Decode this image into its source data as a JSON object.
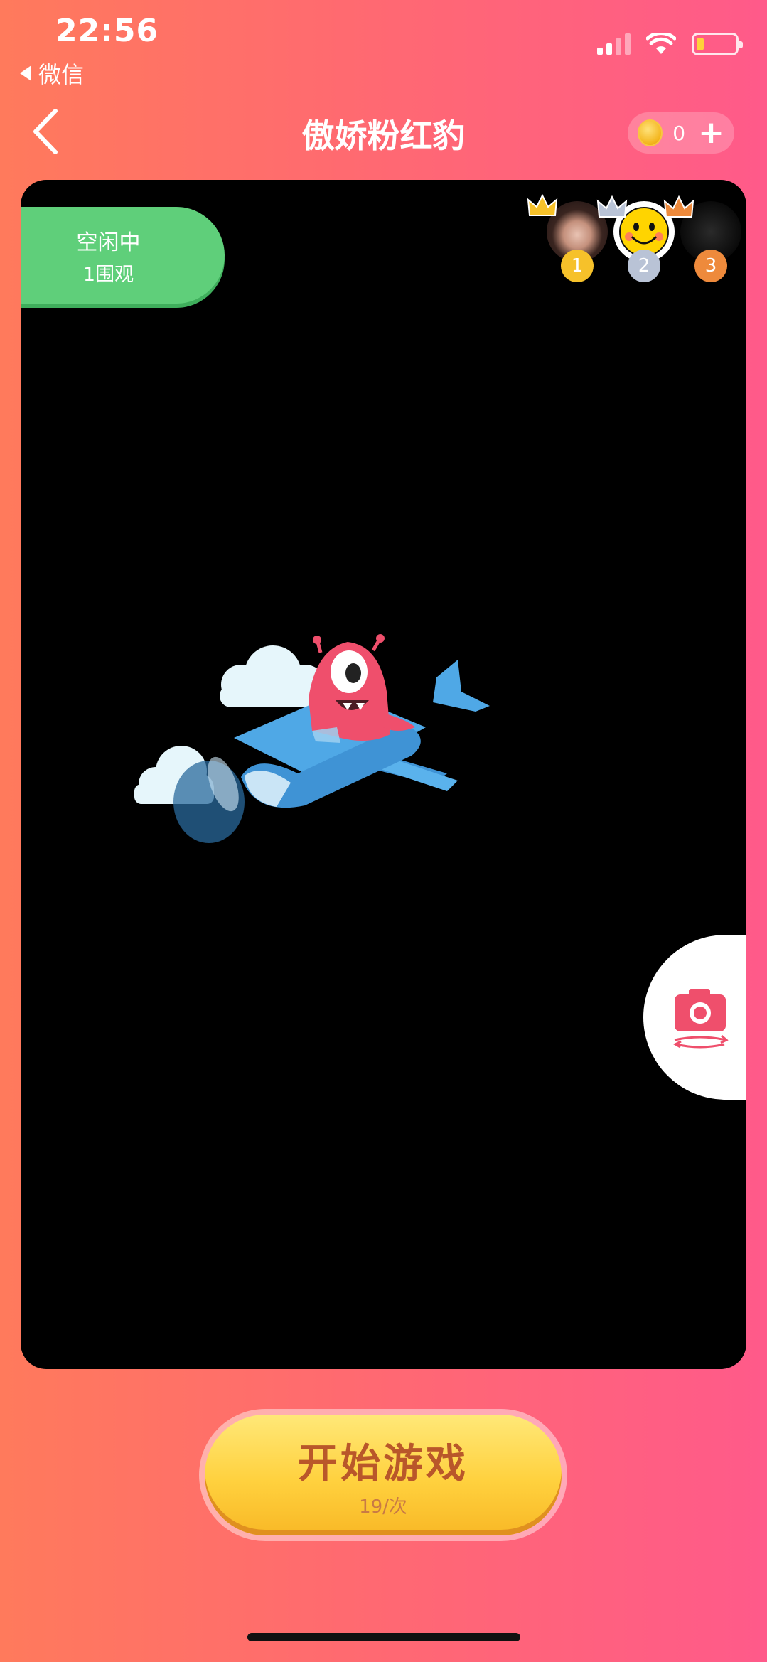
{
  "status_bar": {
    "time": "22:56",
    "back_label": "微信"
  },
  "header": {
    "title": "傲娇粉红豹",
    "coins": "0",
    "add_symbol": "+"
  },
  "machine": {
    "status": "空闲中",
    "viewers": "1围观"
  },
  "ranking": [
    {
      "rank": "1",
      "color": "#f6c12a"
    },
    {
      "rank": "2",
      "color": "#b9c3d6"
    },
    {
      "rank": "3",
      "color": "#ee8a3c"
    }
  ],
  "start_button": {
    "label": "开始游戏",
    "price": "19/次"
  },
  "colors": {
    "accent": "#ff5a8a",
    "status_green": "#5fcf7a",
    "button_yellow": "#ffd13e",
    "camera_pink": "#ef4f6c"
  }
}
